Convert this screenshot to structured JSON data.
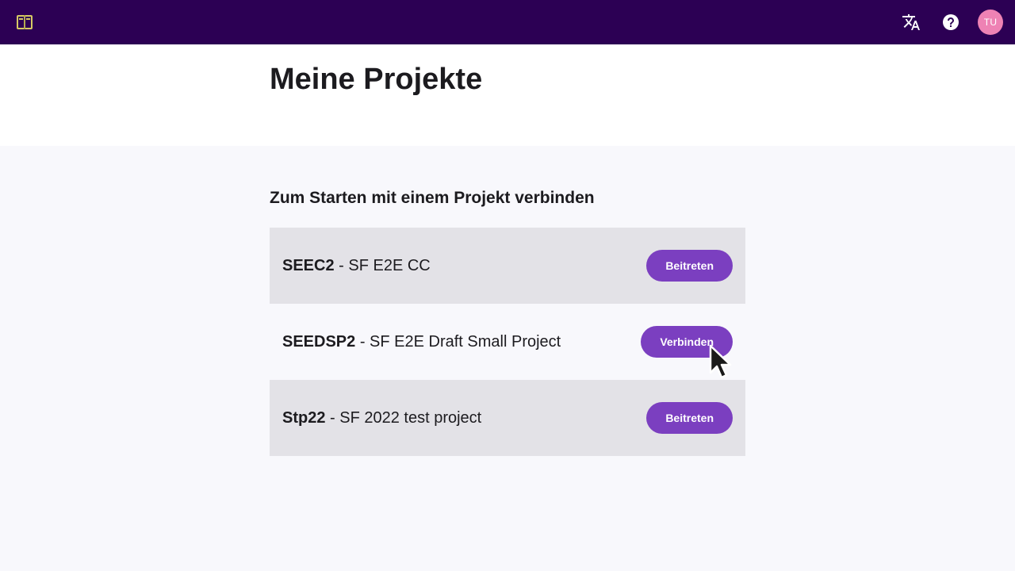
{
  "header": {
    "logo_icon": "book-logo-icon",
    "translate_icon": "translate-icon",
    "help_icon": "help-icon",
    "avatar_initials": "TU",
    "bg_color": "#2c0054",
    "avatar_color": "#ee82b4"
  },
  "page": {
    "title": "Meine Projekte",
    "section_title": "Zum Starten mit einem Projekt verbinden"
  },
  "projects": [
    {
      "code": "SEEC2",
      "name": " - SF E2E CC",
      "button": "Beitreten"
    },
    {
      "code": "SEEDSP2",
      "name": " - SF E2E Draft Small Project",
      "button": "Verbinden"
    },
    {
      "code": "Stp22",
      "name": " - SF 2022 test project",
      "button": "Beitreten"
    }
  ],
  "colors": {
    "button": "#7b3fc0",
    "row_alt": "#e3e2e7",
    "background": "#f8f8fc"
  }
}
